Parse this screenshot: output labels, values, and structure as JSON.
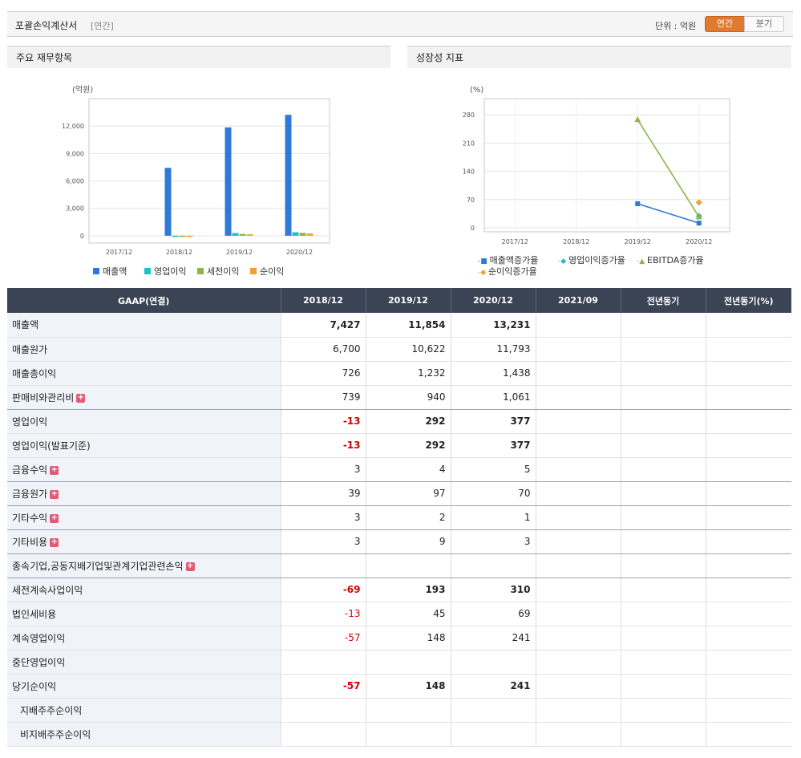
{
  "header": {
    "title": "포괄손익계산서",
    "subtitle": "[연간]",
    "unit_label": "단위 : 억원",
    "toggle_annual": "연간",
    "toggle_quarter": "분기"
  },
  "panels": {
    "left_title": "주요 재무항목",
    "right_title": "성장성 지표"
  },
  "colors": {
    "revenue": "#2e7ad6",
    "operating_profit": "#22bcc6",
    "pretax": "#8ab54a",
    "net": "#f0a030",
    "header_bg": "#3a4454",
    "toggle_active": "#e07a31",
    "negative": "#d40000"
  },
  "chart_data": [
    {
      "type": "bar",
      "ylabel": "(억원)",
      "categories": [
        "2017/12",
        "2018/12",
        "2019/12",
        "2020/12"
      ],
      "ylim": [
        -800,
        15000
      ],
      "yticks": [
        0,
        3000,
        6000,
        9000,
        12000
      ],
      "ytick_labels": [
        "0",
        "3,000",
        "6,000",
        "9,000",
        "12,000"
      ],
      "legend_position": "bottom",
      "series": [
        {
          "name": "매출액",
          "values": [
            null,
            7427,
            11854,
            13231
          ]
        },
        {
          "name": "영업이익",
          "values": [
            null,
            -13,
            292,
            377
          ]
        },
        {
          "name": "세전이익",
          "values": [
            null,
            -69,
            193,
            310
          ]
        },
        {
          "name": "순이익",
          "values": [
            null,
            -57,
            148,
            241
          ]
        }
      ]
    },
    {
      "type": "line",
      "ylabel": "(%)",
      "categories": [
        "2017/12",
        "2018/12",
        "2019/12",
        "2020/12"
      ],
      "ylim": [
        -10,
        320
      ],
      "yticks": [
        0,
        70,
        140,
        210,
        280
      ],
      "ytick_labels": [
        "0",
        "70",
        "140",
        "210",
        "280"
      ],
      "legend_position": "bottom",
      "series": [
        {
          "name": "매출액증가율",
          "values": [
            null,
            null,
            59.6,
            11.6
          ]
        },
        {
          "name": "영업이익증가율",
          "values": [
            null,
            null,
            null,
            29.1
          ]
        },
        {
          "name": "EBITDA증가율",
          "values": [
            null,
            null,
            268,
            27
          ]
        },
        {
          "name": "순이익증가율",
          "values": [
            null,
            null,
            null,
            62.8
          ]
        }
      ]
    }
  ],
  "table": {
    "columns": [
      "GAAP(연결)",
      "2018/12",
      "2019/12",
      "2020/12",
      "2021/09",
      "전년동기",
      "전년동기(%)"
    ],
    "rows": [
      {
        "label": "매출액",
        "values": [
          "7,427",
          "11,854",
          "13,231",
          "",
          "",
          ""
        ],
        "bold": true,
        "neg": false,
        "sep": false,
        "plus": false,
        "indent": false
      },
      {
        "label": "매출원가",
        "values": [
          "6,700",
          "10,622",
          "11,793",
          "",
          "",
          ""
        ],
        "bold": false,
        "neg": false,
        "sep": false,
        "plus": false,
        "indent": false
      },
      {
        "label": "매출총이익",
        "values": [
          "726",
          "1,232",
          "1,438",
          "",
          "",
          ""
        ],
        "bold": false,
        "neg": false,
        "sep": false,
        "plus": false,
        "indent": false
      },
      {
        "label": "판매비와관리비",
        "values": [
          "739",
          "940",
          "1,061",
          "",
          "",
          ""
        ],
        "bold": false,
        "neg": false,
        "sep": true,
        "plus": true,
        "indent": false
      },
      {
        "label": "영업이익",
        "values": [
          "-13",
          "292",
          "377",
          "",
          "",
          ""
        ],
        "bold": true,
        "neg": true,
        "sep": false,
        "plus": false,
        "indent": false
      },
      {
        "label": "영업이익(발표기준)",
        "values": [
          "-13",
          "292",
          "377",
          "",
          "",
          ""
        ],
        "bold": true,
        "neg": true,
        "sep": false,
        "plus": false,
        "indent": false
      },
      {
        "label": "금융수익",
        "values": [
          "3",
          "4",
          "5",
          "",
          "",
          ""
        ],
        "bold": false,
        "neg": false,
        "sep": true,
        "plus": true,
        "indent": false
      },
      {
        "label": "금융원가",
        "values": [
          "39",
          "97",
          "70",
          "",
          "",
          ""
        ],
        "bold": false,
        "neg": false,
        "sep": true,
        "plus": true,
        "indent": false
      },
      {
        "label": "기타수익",
        "values": [
          "3",
          "2",
          "1",
          "",
          "",
          ""
        ],
        "bold": false,
        "neg": false,
        "sep": true,
        "plus": true,
        "indent": false
      },
      {
        "label": "기타비용",
        "values": [
          "3",
          "9",
          "3",
          "",
          "",
          ""
        ],
        "bold": false,
        "neg": false,
        "sep": true,
        "plus": true,
        "indent": false
      },
      {
        "label": "종속기업,공동지배기업및관계기업관련손익",
        "values": [
          "",
          "",
          "",
          "",
          "",
          ""
        ],
        "bold": false,
        "neg": false,
        "sep": true,
        "plus": true,
        "indent": false
      },
      {
        "label": "세전계속사업이익",
        "values": [
          "-69",
          "193",
          "310",
          "",
          "",
          ""
        ],
        "bold": true,
        "neg": true,
        "sep": false,
        "plus": false,
        "indent": false
      },
      {
        "label": "법인세비용",
        "values": [
          "-13",
          "45",
          "69",
          "",
          "",
          ""
        ],
        "bold": false,
        "neg": true,
        "sep": false,
        "plus": false,
        "indent": false
      },
      {
        "label": "계속영업이익",
        "values": [
          "-57",
          "148",
          "241",
          "",
          "",
          ""
        ],
        "bold": false,
        "neg": true,
        "sep": false,
        "plus": false,
        "indent": false
      },
      {
        "label": "중단영업이익",
        "values": [
          "",
          "",
          "",
          "",
          "",
          ""
        ],
        "bold": false,
        "neg": false,
        "sep": false,
        "plus": false,
        "indent": false
      },
      {
        "label": "당기순이익",
        "values": [
          "-57",
          "148",
          "241",
          "",
          "",
          ""
        ],
        "bold": true,
        "neg": true,
        "sep": false,
        "plus": false,
        "indent": false
      },
      {
        "label": "지배주주순이익",
        "values": [
          "",
          "",
          "",
          "",
          "",
          ""
        ],
        "bold": false,
        "neg": false,
        "sep": false,
        "plus": false,
        "indent": true
      },
      {
        "label": "비지배주주순이익",
        "values": [
          "",
          "",
          "",
          "",
          "",
          ""
        ],
        "bold": false,
        "neg": false,
        "sep": false,
        "plus": false,
        "indent": true
      }
    ]
  }
}
